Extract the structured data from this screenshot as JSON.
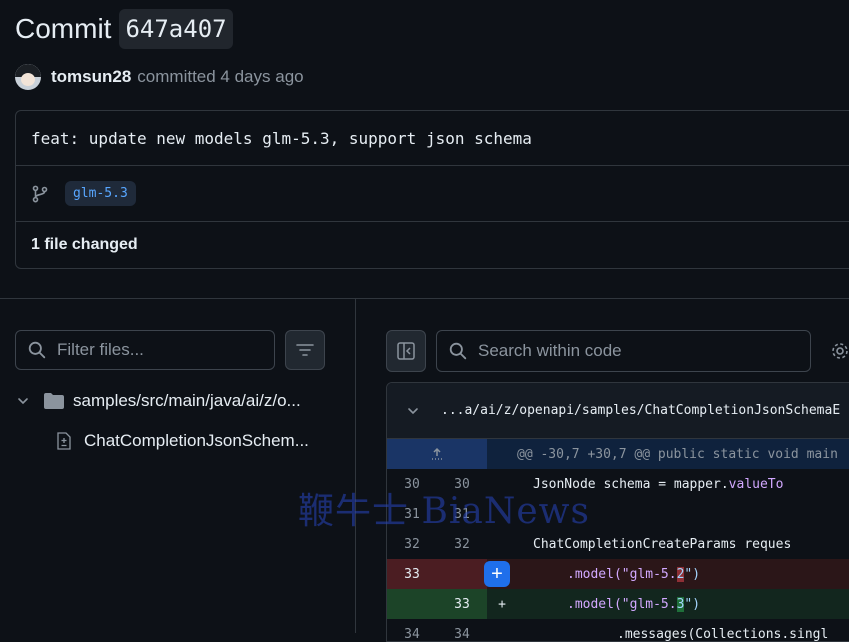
{
  "header": {
    "title_word": "Commit",
    "sha": "647a407",
    "author": "tomsun28",
    "meta": "committed 4 days ago"
  },
  "commit": {
    "message": "feat: update new models glm-5.3, support json schema",
    "branch": "glm-5.3",
    "files_changed": "1 file changed"
  },
  "file_tree": {
    "filter_placeholder": "Filter files...",
    "folder": "samples/src/main/java/ai/z/o...",
    "file": "ChatCompletionJsonSchem..."
  },
  "diff_toolbar": {
    "search_placeholder": "Search within code"
  },
  "diff": {
    "file_path": "...a/ai/z/openapi/samples/ChatCompletionJsonSchemaE",
    "hunk": "@@ -30,7 +30,7 @@ public static void main",
    "lines": [
      {
        "old": "30",
        "new": "30",
        "code": "JsonNode schema = mapper.valueTo"
      },
      {
        "old": "31",
        "new": "31",
        "code": ""
      },
      {
        "old": "32",
        "new": "32",
        "code": "ChatCompletionCreateParams reques"
      },
      {
        "old": "33",
        "new": "",
        "code_pre": ".model(\"glm-5.",
        "code_hl": "2",
        "code_post": "\")"
      },
      {
        "old": "",
        "new": "33",
        "sign": "+",
        "code_pre": ".model(\"glm-5.",
        "code_hl": "3",
        "code_post": "\")"
      },
      {
        "old": "34",
        "new": "34",
        "code": ".messages(Collections.singl"
      }
    ]
  },
  "watermark": "鞭牛士 BiaNews",
  "colors": {
    "background": "#0d1117",
    "accent": "#1f6feb",
    "deleted_line": "#2b1618",
    "added_line": "#12261e"
  }
}
